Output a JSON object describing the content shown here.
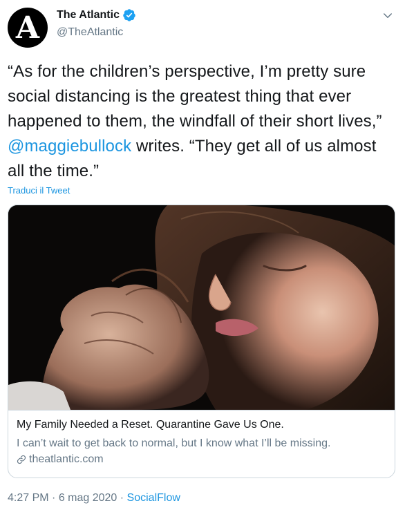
{
  "author": {
    "display_name": "The Atlantic",
    "handle": "@TheAtlantic",
    "avatar_letter": "A",
    "verified": true
  },
  "tweet": {
    "text_part1": "“As for the children’s perspective, I’m pretty sure social distancing is the greatest thing that ever happened to them, the windfall of their short lives,” ",
    "mention": "@maggiebullock",
    "text_part2": " writes. “They get all of us almost all the time.”",
    "translate_label": "Traduci il Tweet"
  },
  "card": {
    "title": "My Family Needed a Reset. Quarantine Gave Us One.",
    "description": "I can’t wait to get back to normal, but I know what I’ll be missing.",
    "domain": "theatlantic.com"
  },
  "meta": {
    "time": "4:27 PM",
    "separator": " · ",
    "date": "6 mag 2020",
    "source": "SocialFlow"
  },
  "colors": {
    "link": "#1b95e0",
    "secondary_text": "#657786",
    "verified_badge": "#1da1f2",
    "border": "#ccd6dd"
  },
  "icons": {
    "verified": "verified-badge-icon",
    "caret": "chevron-down-icon",
    "link": "link-icon"
  }
}
